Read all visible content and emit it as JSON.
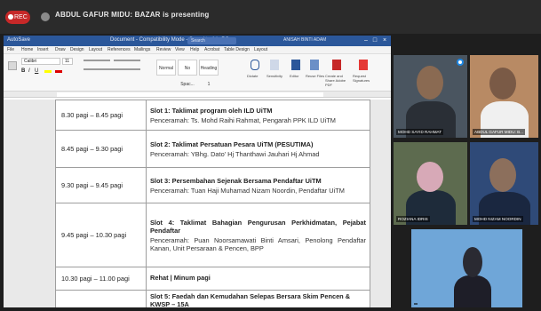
{
  "meeting": {
    "rec_label": "REC",
    "presenter_text": "ABDUL GAFUR MIDU: BAZAR is presenting"
  },
  "word": {
    "autosave": "AutoSave",
    "doc_title": "Document - Compatibility Mode - Saved to this PC",
    "search_placeholder": "Search",
    "user": "ANISAH BINTI ADAM",
    "menu": [
      "File",
      "Home",
      "Insert",
      "Draw",
      "Design",
      "Layout",
      "References",
      "Mailings",
      "Review",
      "View",
      "Help",
      "Acrobat",
      "Table Design",
      "Layout"
    ],
    "font_name": "Calibri",
    "font_size": "11",
    "styles": [
      "Normal",
      "No Spac...",
      "Heading 1"
    ],
    "ribbon_groups": [
      "Dictate",
      "Sensitivity",
      "Editor",
      "Reuse Files",
      "Create and Share Adobe PDF",
      "Request Signatures"
    ]
  },
  "schedule": [
    {
      "time": "8.30 pagi – 8.45 pagi",
      "title": "Slot 1: Taklimat program oleh ILD UiTM",
      "speaker": "Penceramah: Ts. Mohd Raihi Rahmat, Pengarah PPK ILD UiTM"
    },
    {
      "time": "8.45 pagi – 9.30 pagi",
      "title": "Slot 2: Taklimat Persatuan Pesara UiTM (PESUTIMA)",
      "speaker": "Penceramah: YBhg. Dato' Hj Thanthawi Jauhari Hj Ahmad"
    },
    {
      "time": "9.30 pagi – 9.45 pagi",
      "title": "Slot 3: Persembahan Sejenak Bersama Pendaftar UiTM",
      "speaker": "Penceramah: Tuan Haji Muhamad Nizam Noordin, Pendaftar UiTM"
    },
    {
      "time": "9.45 pagi – 10.30 pagi",
      "title": "Slot 4: Taklimat Bahagian Pengurusan Perkhidmatan, Pejabat Pendaftar",
      "speaker": "Penceramah: Puan Noorsamawati Binti Amsari, Penolong Pendaftar Kanan, Unit Persaraan & Pencen, BPP"
    },
    {
      "time": "10.30 pagi – 11.00 pagi",
      "title": "Rehat | Minum pagi",
      "speaker": ""
    },
    {
      "time": "",
      "title": "Slot 5: Faedah dan Kemudahan Selepas Bersara Skim Pencen & KWSP – 15A",
      "speaker": ""
    }
  ],
  "participants": [
    {
      "name": "MOHD SAYID RAHMAT",
      "active": true
    },
    {
      "name": "ABDUL GAFUR MIDU: B...",
      "active": false
    },
    {
      "name": "ROZIANA IDRIS",
      "active": false
    },
    {
      "name": "MOHD NIZAM NOORDIN",
      "active": false
    },
    {
      "name": "",
      "active": false
    }
  ],
  "colors": {
    "word_blue": "#2b579a",
    "rec_red": "#c62828",
    "active_blue": "#1e88e5"
  }
}
